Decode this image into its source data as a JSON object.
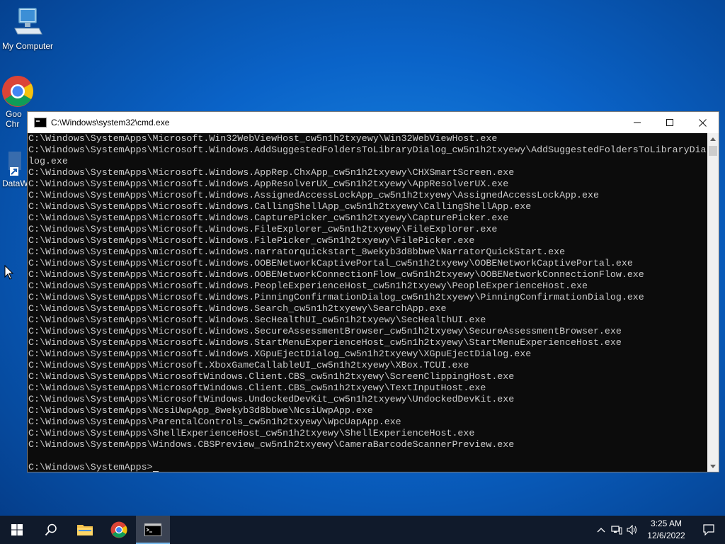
{
  "desktop": {
    "icons": [
      {
        "label": "My Computer",
        "icon": "computer-icon"
      },
      {
        "label": "Goo Chr",
        "icon": "chrome-icon"
      },
      {
        "label": "DataW",
        "icon": "app-shortcut-icon"
      }
    ]
  },
  "window": {
    "title": "C:\\Windows\\system32\\cmd.exe",
    "buttons": {
      "minimize": "—",
      "maximize": "☐",
      "close": "✕"
    }
  },
  "console": {
    "lines": [
      "C:\\Windows\\SystemApps\\Microsoft.Win32WebViewHost_cw5n1h2txyewy\\Win32WebViewHost.exe",
      "C:\\Windows\\SystemApps\\Microsoft.Windows.AddSuggestedFoldersToLibraryDialog_cw5n1h2txyewy\\AddSuggestedFoldersToLibraryDia",
      "log.exe",
      "C:\\Windows\\SystemApps\\Microsoft.Windows.AppRep.ChxApp_cw5n1h2txyewy\\CHXSmartScreen.exe",
      "C:\\Windows\\SystemApps\\Microsoft.Windows.AppResolverUX_cw5n1h2txyewy\\AppResolverUX.exe",
      "C:\\Windows\\SystemApps\\Microsoft.Windows.AssignedAccessLockApp_cw5n1h2txyewy\\AssignedAccessLockApp.exe",
      "C:\\Windows\\SystemApps\\Microsoft.Windows.CallingShellApp_cw5n1h2txyewy\\CallingShellApp.exe",
      "C:\\Windows\\SystemApps\\Microsoft.Windows.CapturePicker_cw5n1h2txyewy\\CapturePicker.exe",
      "C:\\Windows\\SystemApps\\Microsoft.Windows.FileExplorer_cw5n1h2txyewy\\FileExplorer.exe",
      "C:\\Windows\\SystemApps\\Microsoft.Windows.FilePicker_cw5n1h2txyewy\\FilePicker.exe",
      "C:\\Windows\\SystemApps\\microsoft.windows.narratorquickstart_8wekyb3d8bbwe\\NarratorQuickStart.exe",
      "C:\\Windows\\SystemApps\\Microsoft.Windows.OOBENetworkCaptivePortal_cw5n1h2txyewy\\OOBENetworkCaptivePortal.exe",
      "C:\\Windows\\SystemApps\\Microsoft.Windows.OOBENetworkConnectionFlow_cw5n1h2txyewy\\OOBENetworkConnectionFlow.exe",
      "C:\\Windows\\SystemApps\\Microsoft.Windows.PeopleExperienceHost_cw5n1h2txyewy\\PeopleExperienceHost.exe",
      "C:\\Windows\\SystemApps\\Microsoft.Windows.PinningConfirmationDialog_cw5n1h2txyewy\\PinningConfirmationDialog.exe",
      "C:\\Windows\\SystemApps\\Microsoft.Windows.Search_cw5n1h2txyewy\\SearchApp.exe",
      "C:\\Windows\\SystemApps\\Microsoft.Windows.SecHealthUI_cw5n1h2txyewy\\SecHealthUI.exe",
      "C:\\Windows\\SystemApps\\Microsoft.Windows.SecureAssessmentBrowser_cw5n1h2txyewy\\SecureAssessmentBrowser.exe",
      "C:\\Windows\\SystemApps\\Microsoft.Windows.StartMenuExperienceHost_cw5n1h2txyewy\\StartMenuExperienceHost.exe",
      "C:\\Windows\\SystemApps\\Microsoft.Windows.XGpuEjectDialog_cw5n1h2txyewy\\XGpuEjectDialog.exe",
      "C:\\Windows\\SystemApps\\Microsoft.XboxGameCallableUI_cw5n1h2txyewy\\XBox.TCUI.exe",
      "C:\\Windows\\SystemApps\\MicrosoftWindows.Client.CBS_cw5n1h2txyewy\\ScreenClippingHost.exe",
      "C:\\Windows\\SystemApps\\MicrosoftWindows.Client.CBS_cw5n1h2txyewy\\TextInputHost.exe",
      "C:\\Windows\\SystemApps\\MicrosoftWindows.UndockedDevKit_cw5n1h2txyewy\\UndockedDevKit.exe",
      "C:\\Windows\\SystemApps\\NcsiUwpApp_8wekyb3d8bbwe\\NcsiUwpApp.exe",
      "C:\\Windows\\SystemApps\\ParentalControls_cw5n1h2txyewy\\WpcUapApp.exe",
      "C:\\Windows\\SystemApps\\ShellExperienceHost_cw5n1h2txyewy\\ShellExperienceHost.exe",
      "C:\\Windows\\SystemApps\\Windows.CBSPreview_cw5n1h2txyewy\\CameraBarcodeScannerPreview.exe",
      ""
    ],
    "prompt": "C:\\Windows\\SystemApps>"
  },
  "taskbar": {
    "items": [
      {
        "name": "start-button",
        "icon": "windows-logo-icon"
      },
      {
        "name": "search-button",
        "icon": "search-icon"
      },
      {
        "name": "file-explorer-button",
        "icon": "folder-icon"
      },
      {
        "name": "chrome-button",
        "icon": "chrome-icon"
      },
      {
        "name": "cmd-button",
        "icon": "cmd-icon",
        "active": true
      }
    ],
    "clock": {
      "time": "3:25 AM",
      "date": "12/6/2022"
    }
  },
  "colors": {
    "console_bg": "#0c0c0c",
    "console_fg": "#cccccc",
    "taskbar_bg": "#101a2b",
    "accent": "#76b9ed"
  }
}
